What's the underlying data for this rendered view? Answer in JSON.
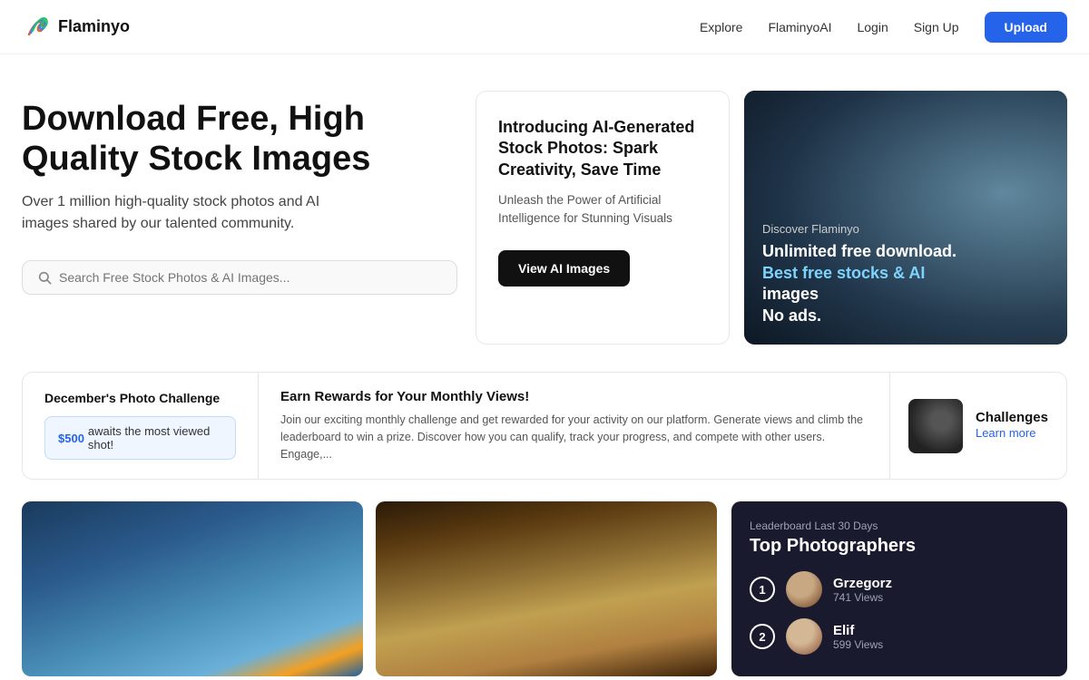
{
  "header": {
    "logo_text": "Flaminyo",
    "nav": {
      "explore": "Explore",
      "flaminyoai": "FlaminyoAI",
      "login": "Login",
      "signup": "Sign Up"
    },
    "upload_label": "Upload"
  },
  "hero": {
    "title": "Download Free, High Quality Stock Images",
    "subtitle": "Over 1 million high-quality stock photos and AI images shared by our talented community.",
    "search_placeholder": "Search Free Stock Photos & AI Images..."
  },
  "ai_card": {
    "title": "Introducing AI-Generated Stock Photos: Spark Creativity, Save Time",
    "desc": "Unleash the Power of Artificial Intelligence for Stunning Visuals",
    "button_label": "View AI Images"
  },
  "discover_card": {
    "label": "Discover Flaminyo",
    "headline_1": "Unlimited free download.",
    "headline_2": "Best free stocks & AI",
    "headline_3": "images",
    "headline_4": "No ads."
  },
  "challenge": {
    "left_title": "December's Photo Challenge",
    "badge_prefix": "$500",
    "badge_suffix": "awaits the most viewed shot!",
    "middle_title": "Earn Rewards for Your Monthly Views!",
    "middle_desc": "Join our exciting monthly challenge and get rewarded for your activity on our platform. Generate views and climb the leaderboard to win a prize. Discover how you can qualify, track your progress, and compete with other users. Engage,...",
    "right_label": "Challenges",
    "right_learn_more": "Learn more"
  },
  "leaderboard": {
    "period": "Leaderboard Last 30 Days",
    "title": "Top Photographers",
    "photographers": [
      {
        "rank": "1",
        "name": "Grzegorz",
        "views": "741 Views"
      },
      {
        "rank": "2",
        "name": "Elif",
        "views": "599 Views"
      }
    ]
  }
}
